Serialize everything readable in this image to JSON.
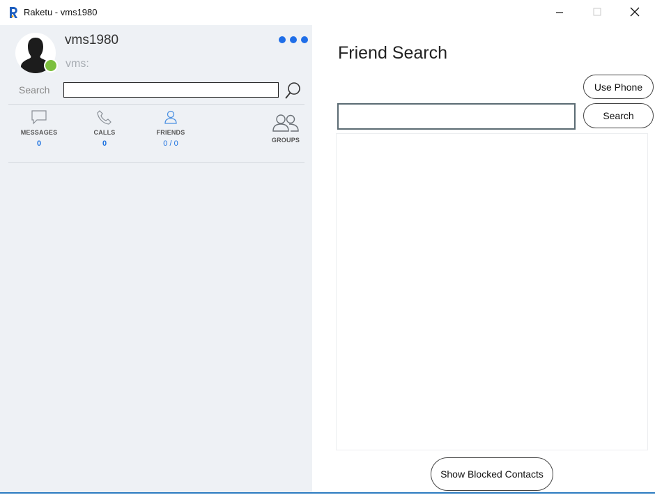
{
  "window": {
    "title": "Raketu - vms1980",
    "logo_icon": "raketu-logo-icon",
    "controls": [
      "minimize-icon",
      "maximize-icon",
      "close-icon"
    ]
  },
  "profile": {
    "username": "vms1980",
    "status_message": "vms:",
    "presence": "online",
    "presence_color": "#7cbf3e",
    "menu_icon": "more-dots-icon"
  },
  "left_search": {
    "label": "Search",
    "value": "",
    "icon": "search-icon"
  },
  "tabs": [
    {
      "label": "MESSAGES",
      "count": "0",
      "icon": "message-icon"
    },
    {
      "label": "CALLS",
      "count": "0",
      "icon": "phone-icon"
    },
    {
      "label": "FRIENDS",
      "count": "0 / 0",
      "icon": "person-icon",
      "active": true
    },
    {
      "label": "GROUPS",
      "count": "",
      "icon": "group-icon"
    }
  ],
  "friend_search": {
    "title": "Friend Search",
    "use_phone_label": "Use Phone",
    "search_label": "Search",
    "input_value": "",
    "show_blocked_label": "Show Blocked Contacts"
  },
  "colors": {
    "accent": "#1f6ee8",
    "left_panel_bg": "#eef1f5",
    "count_blue": "#1f73e0"
  }
}
